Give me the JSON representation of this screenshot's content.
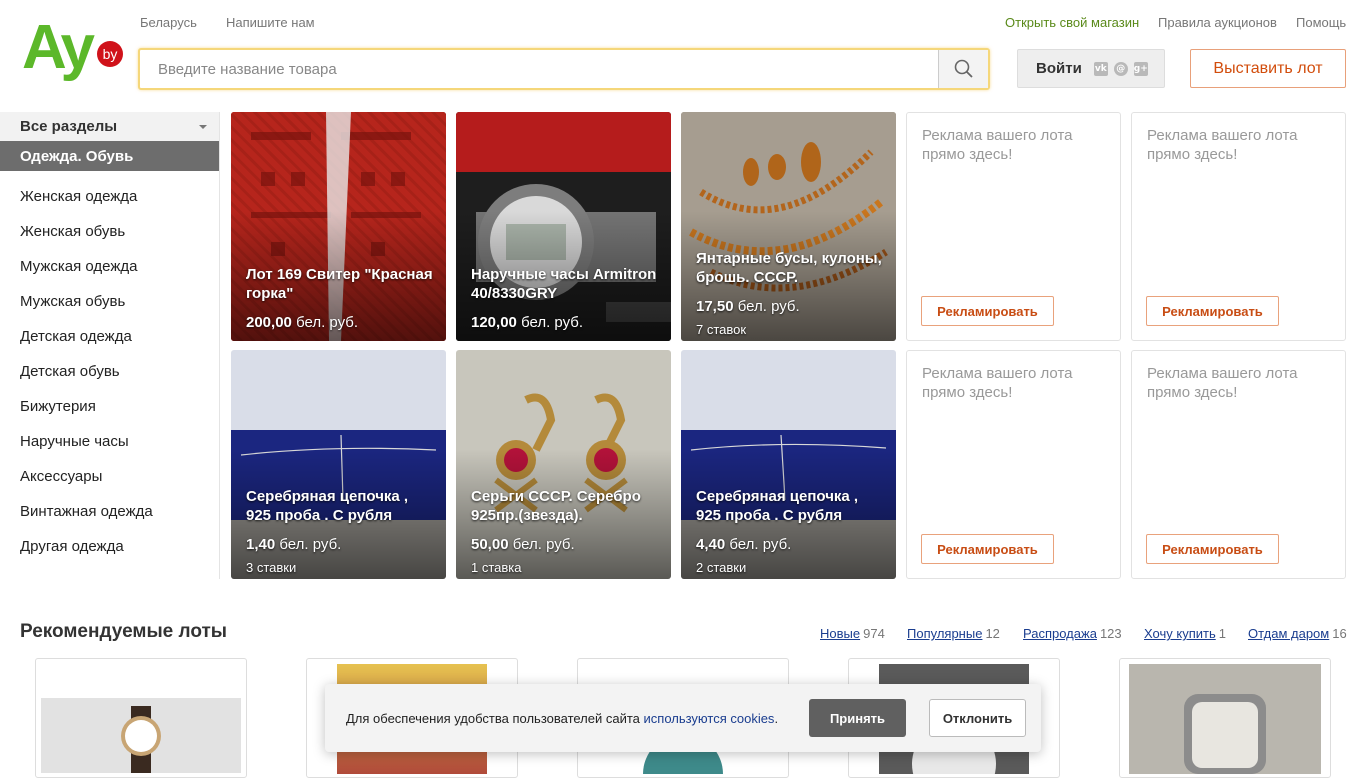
{
  "header": {
    "logo": {
      "text": "Ay",
      "badge": "by",
      "color": "#5cb82a",
      "badge_color": "#d0121a"
    },
    "nav_left": [
      "Беларусь",
      "Напишите нам"
    ],
    "nav_right": [
      "Открыть свой магазин",
      "Правила аукционов",
      "Помощь"
    ],
    "search_placeholder": "Введите название товара",
    "login_label": "Войти",
    "social_icons": [
      "vk-icon",
      "odnoklassniki-icon",
      "google-plus-icon"
    ],
    "sell_label": "Выставить лот"
  },
  "sidebar": {
    "all_sections": "Все разделы",
    "active_category": "Одежда. Обувь",
    "items": [
      "Женская одежда",
      "Женская обувь",
      "Мужская одежда",
      "Мужская обувь",
      "Детская одежда",
      "Детская обувь",
      "Бижутерия",
      "Наручные часы",
      "Аксессуары",
      "Винтажная одежда",
      "Другая одежда"
    ]
  },
  "lots": [
    {
      "title": "Лот 169 Свитер \"Красная горка\"",
      "price": "200,00",
      "currency": "бел. руб.",
      "bids": ""
    },
    {
      "title": "Наручные часы Armitron 40/8330GRY",
      "price": "120,00",
      "currency": "бел. руб.",
      "bids": ""
    },
    {
      "title": "Янтарные бусы, кулоны, брошь. СССР.",
      "price": "17,50",
      "currency": "бел. руб.",
      "bids": "7 ставок"
    },
    {
      "title": "Серебряная цепочка , 925 проба . С рубля",
      "price": "1,40",
      "currency": "бел. руб.",
      "bids": "3 ставки"
    },
    {
      "title": "Серьги СССР. Серебро 925пр.(звезда).",
      "price": "50,00",
      "currency": "бел. руб.",
      "bids": "1 ставка"
    },
    {
      "title": "Серебряная цепочка , 925 проба . С рубля",
      "price": "4,40",
      "currency": "бел. руб.",
      "bids": "2 ставки"
    }
  ],
  "ads": {
    "text": "Реклама вашего лота прямо здесь!",
    "button": "Рекламировать"
  },
  "recommended": {
    "title": "Рекомендуемые лоты",
    "tabs": [
      {
        "label": "Новые",
        "count": "974"
      },
      {
        "label": "Популярные",
        "count": "12"
      },
      {
        "label": "Распродажа",
        "count": "123"
      },
      {
        "label": "Хочу купить",
        "count": "1"
      },
      {
        "label": "Отдам даром",
        "count": "16"
      }
    ]
  },
  "cookie": {
    "text": "Для обеспечения удобства пользователей сайта",
    "link": "используются cookies",
    "accept": "Принять",
    "decline": "Отклонить"
  },
  "colors": {
    "accent": "#d24d0c",
    "brand_green": "#5cb82a",
    "link": "#1a3d8f",
    "shop_link": "#5a8a1a"
  }
}
